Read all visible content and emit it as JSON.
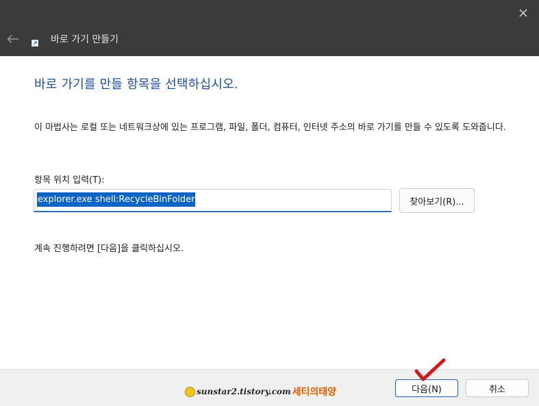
{
  "window": {
    "title": "바로 가기 만들기"
  },
  "wizard": {
    "heading": "바로 가기를 만들 항목을 선택하십시오.",
    "description": "이 마법사는 로컬 또는 네트워크상에 있는 프로그램, 파일, 폴더, 컴퓨터, 인터넷 주소의 바로 가기를 만들 수 있도록 도와줍니다.",
    "field_label": "항목 위치 입력(T):",
    "location_value": "explorer.exe shell:RecycleBinFolder",
    "browse_label": "찾아보기(R)...",
    "continue_text": "계속 진행하려면 [다음]을 클릭하십시오."
  },
  "footer": {
    "next_label": "다음(N)",
    "cancel_label": "취소"
  },
  "watermark": {
    "url": "sunstar2.tistory.com",
    "name": "세티의태양"
  },
  "icons": {
    "back": "back-arrow-icon",
    "close": "close-icon",
    "shortcut": "shortcut-arrow-icon",
    "check": "red-check-icon"
  }
}
